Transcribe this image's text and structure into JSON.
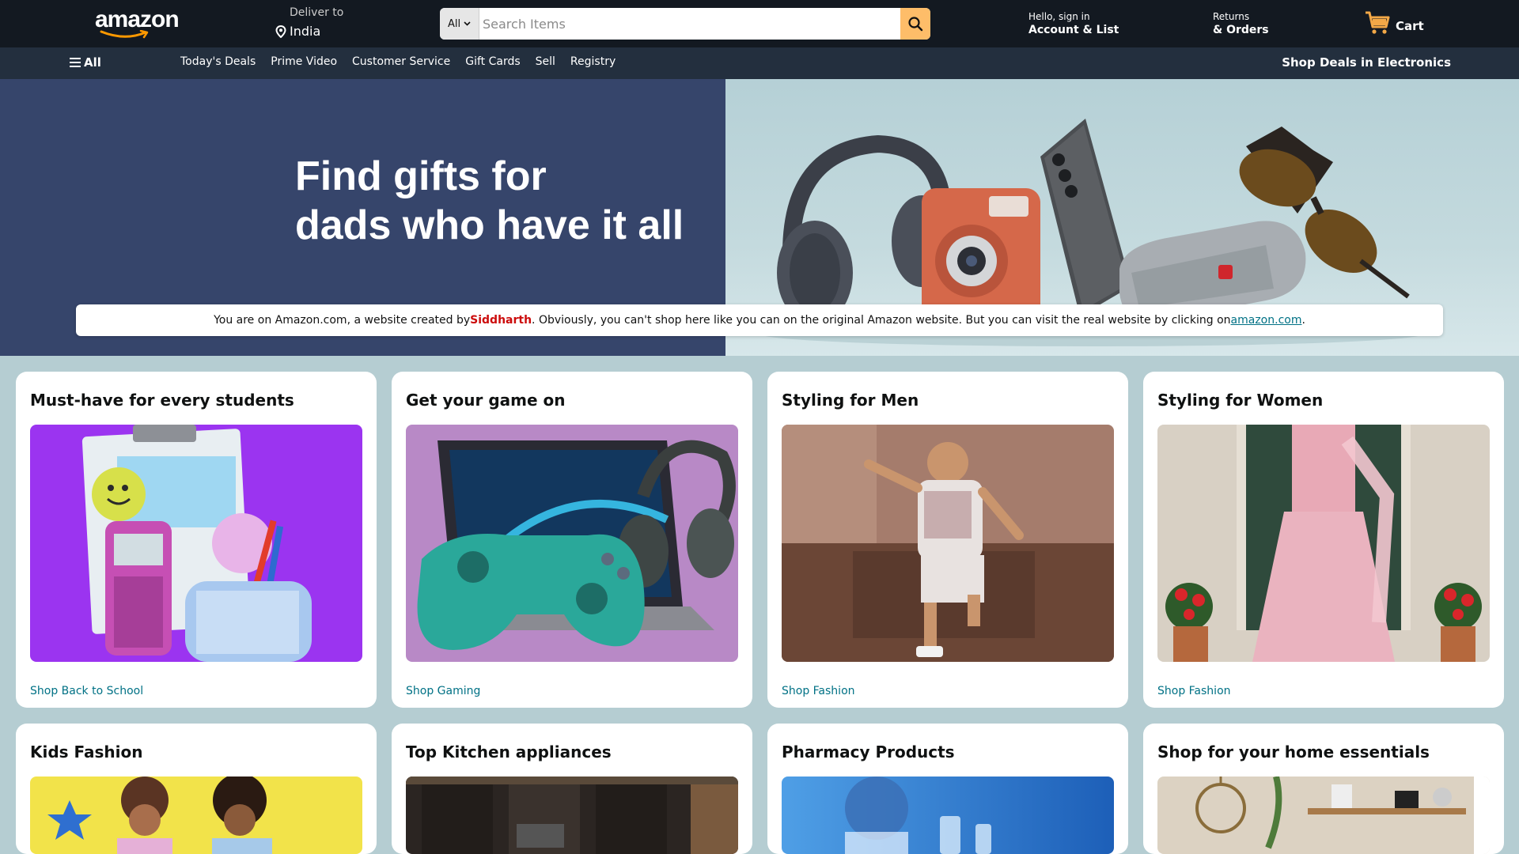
{
  "header": {
    "logo_text": "amazon",
    "deliver_label": "Deliver to",
    "deliver_location": "India",
    "search": {
      "category": "All",
      "placeholder": "Search Items"
    },
    "account": {
      "greeting": "Hello, sign in",
      "label": "Account & List"
    },
    "returns": {
      "line1": "Returns",
      "line2": "& Orders"
    },
    "cart_label": "Cart"
  },
  "subnav": {
    "all_label": "All",
    "links": [
      "Today's Deals",
      "Prime Video",
      "Customer Service",
      "Gift Cards",
      "Sell",
      "Registry"
    ],
    "promo": "Shop Deals in Electronics"
  },
  "hero": {
    "title_line1": "Find gifts for",
    "title_line2": "dads who have it all"
  },
  "notice": {
    "prefix": "You are on Amazon.com, a website created by ",
    "name": "Siddharth",
    "middle": ". Obviously, you can't shop here like you can on the original Amazon website. But you can visit the real website by clicking on ",
    "link": "amazon.com",
    "suffix": "."
  },
  "cards": [
    {
      "title": "Must-have for every students",
      "link": "Shop Back to School",
      "icon": "school-supplies-image"
    },
    {
      "title": "Get your game on",
      "link": "Shop Gaming",
      "icon": "gaming-image"
    },
    {
      "title": "Styling for Men",
      "link": "Shop Fashion",
      "icon": "men-fashion-image"
    },
    {
      "title": "Styling for Women",
      "link": "Shop Fashion",
      "icon": "women-fashion-image"
    },
    {
      "title": "Kids Fashion",
      "link": "",
      "icon": "kids-fashion-image"
    },
    {
      "title": "Top Kitchen appliances",
      "link": "",
      "icon": "kitchen-image"
    },
    {
      "title": "Pharmacy Products",
      "link": "",
      "icon": "pharmacy-image"
    },
    {
      "title": "Shop for your home essentials",
      "link": "",
      "icon": "home-essentials-image"
    }
  ],
  "colors": {
    "header_bg": "#131921",
    "subnav_bg": "#232f3e",
    "accent": "#febd69",
    "link": "#007185",
    "page_bg": "#b5cdd2"
  }
}
